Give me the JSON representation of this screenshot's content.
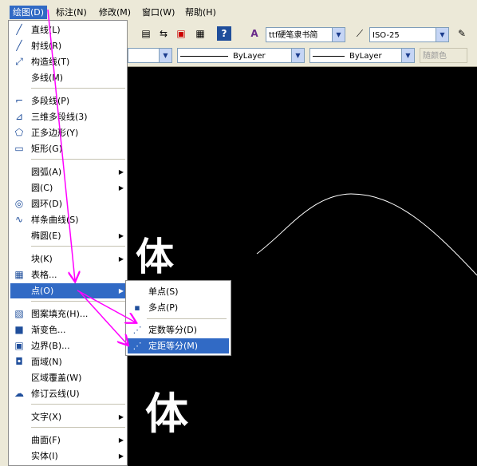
{
  "menubar": {
    "items": [
      {
        "label": "绘图(D)",
        "active": true
      },
      {
        "label": "标注(N)"
      },
      {
        "label": "修改(M)"
      },
      {
        "label": "窗口(W)"
      },
      {
        "label": "帮助(H)"
      }
    ]
  },
  "toolbar": {
    "text_style": "ttf硬笔隶书简",
    "dim_style": "ISO-25",
    "linetype": "ByLayer",
    "lineweight": "ByLayer",
    "color_label": "随颜色"
  },
  "draw_menu": {
    "items": [
      {
        "label": "直线(L)",
        "icon": "line-icon"
      },
      {
        "label": "射线(R)",
        "icon": "ray-icon"
      },
      {
        "label": "构造线(T)",
        "icon": "xline-icon"
      },
      {
        "label": "多线(M)"
      },
      {
        "label": "多段线(P)",
        "icon": "polyline-icon"
      },
      {
        "label": "三维多段线(3)",
        "icon": "3dpolyline-icon"
      },
      {
        "label": "正多边形(Y)",
        "icon": "polygon-icon"
      },
      {
        "label": "矩形(G)",
        "icon": "rectangle-icon"
      },
      {
        "label": "圆弧(A)",
        "submenu": true
      },
      {
        "label": "圆(C)",
        "submenu": true
      },
      {
        "label": "圆环(D)",
        "icon": "donut-icon"
      },
      {
        "label": "样条曲线(S)",
        "icon": "spline-icon"
      },
      {
        "label": "椭圆(E)",
        "submenu": true
      },
      {
        "label": "块(K)",
        "submenu": true
      },
      {
        "label": "表格...",
        "icon": "table-icon"
      },
      {
        "label": "点(O)",
        "submenu": true,
        "highlighted": true
      },
      {
        "label": "图案填充(H)...",
        "icon": "hatch-icon"
      },
      {
        "label": "渐变色...",
        "icon": "gradient-icon"
      },
      {
        "label": "边界(B)...",
        "icon": "boundary-icon"
      },
      {
        "label": "面域(N)",
        "icon": "region-icon"
      },
      {
        "label": "区域覆盖(W)"
      },
      {
        "label": "修订云线(U)",
        "icon": "revcloud-icon"
      },
      {
        "label": "文字(X)",
        "submenu": true
      },
      {
        "label": "曲面(F)",
        "submenu": true
      },
      {
        "label": "实体(I)",
        "submenu": true
      }
    ]
  },
  "point_submenu": {
    "items": [
      {
        "label": "单点(S)"
      },
      {
        "label": "多点(P)",
        "icon": "point-icon"
      },
      {
        "label": "定数等分(D)",
        "icon": "divide-icon"
      },
      {
        "label": "定距等分(M)",
        "icon": "measure-icon",
        "highlighted": true
      }
    ]
  },
  "canvas": {
    "text_1": "体",
    "text_2": "体"
  },
  "colors": {
    "menu_highlight": "#316ac5",
    "annotation_arrow": "#ff00ff",
    "canvas_bg": "#000000"
  }
}
